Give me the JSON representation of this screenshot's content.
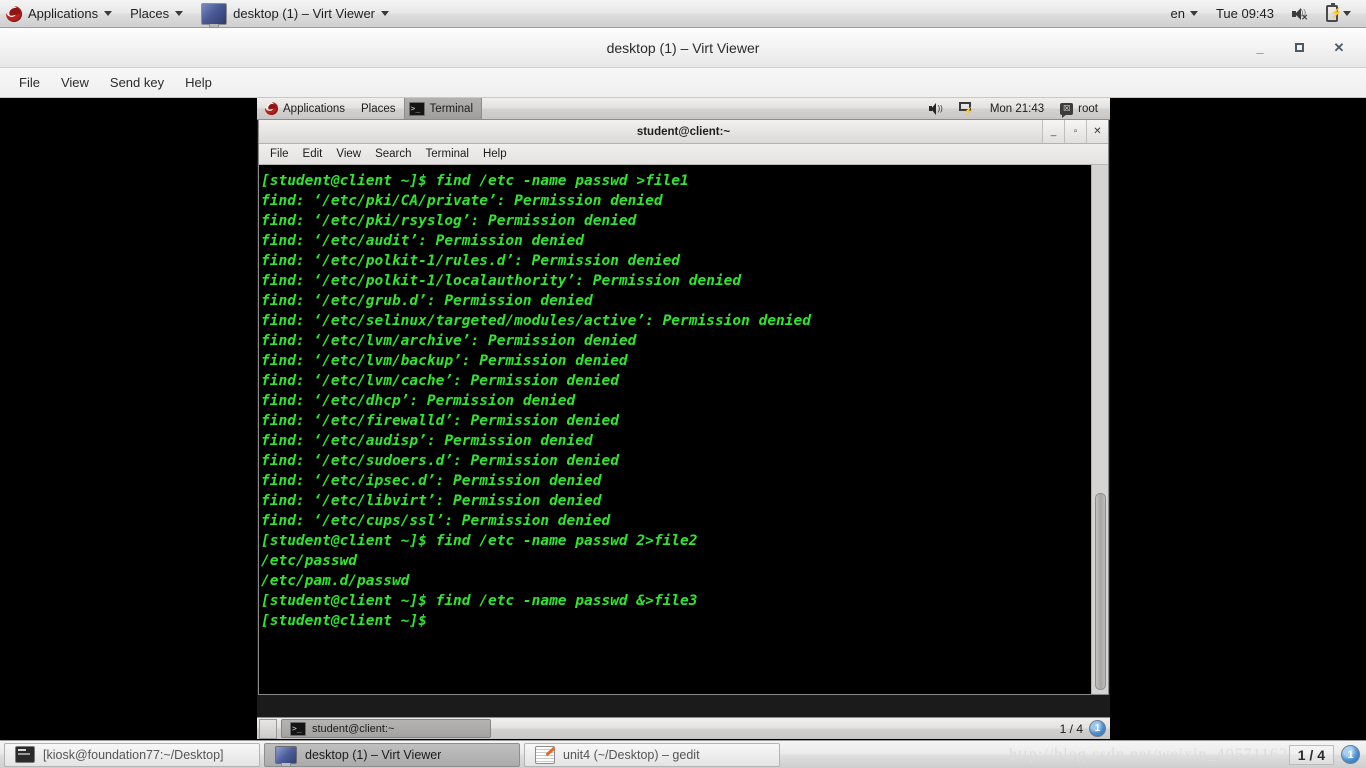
{
  "host_top_panel": {
    "applications_label": "Applications",
    "places_label": "Places",
    "window_task_label": "desktop (1) – Virt Viewer",
    "keyboard_layout": "en",
    "clock": "Tue 09:43"
  },
  "virt_viewer": {
    "title": "desktop (1) – Virt Viewer",
    "menu": [
      "File",
      "View",
      "Send key",
      "Help"
    ],
    "window_buttons": {
      "minimize": "_",
      "maximize": "□",
      "close": "✕"
    }
  },
  "guest": {
    "top_panel": {
      "applications_label": "Applications",
      "places_label": "Places",
      "task_label": "Terminal",
      "clock": "Mon 21:43",
      "user": "root"
    },
    "terminal": {
      "title": "student@client:~",
      "menu": [
        "File",
        "Edit",
        "View",
        "Search",
        "Terminal",
        "Help"
      ],
      "window_buttons": {
        "minimize": "_",
        "maximize": "▫",
        "close": "✕"
      },
      "lines": [
        "[student@client ~]$ find /etc -name passwd >file1",
        "find: ‘/etc/pki/CA/private’: Permission denied",
        "find: ‘/etc/pki/rsyslog’: Permission denied",
        "find: ‘/etc/audit’: Permission denied",
        "find: ‘/etc/polkit-1/rules.d’: Permission denied",
        "find: ‘/etc/polkit-1/localauthority’: Permission denied",
        "find: ‘/etc/grub.d’: Permission denied",
        "find: ‘/etc/selinux/targeted/modules/active’: Permission denied",
        "find: ‘/etc/lvm/archive’: Permission denied",
        "find: ‘/etc/lvm/backup’: Permission denied",
        "find: ‘/etc/lvm/cache’: Permission denied",
        "find: ‘/etc/dhcp’: Permission denied",
        "find: ‘/etc/firewalld’: Permission denied",
        "find: ‘/etc/audisp’: Permission denied",
        "find: ‘/etc/sudoers.d’: Permission denied",
        "find: ‘/etc/ipsec.d’: Permission denied",
        "find: ‘/etc/libvirt’: Permission denied",
        "find: ‘/etc/cups/ssl’: Permission denied",
        "[student@client ~]$ find /etc -name passwd 2>file2",
        "/etc/passwd",
        "/etc/pam.d/passwd",
        "[student@client ~]$ find /etc -name passwd &>file3",
        "[student@client ~]$"
      ],
      "foreground_color": "#2ee62e",
      "background_color": "#000000"
    },
    "bottom_panel": {
      "task_label": "student@client:~",
      "pager": "1 / 4",
      "workspace_badge": "1"
    }
  },
  "host_bottom_panel": {
    "tasks": [
      {
        "label": "[kiosk@foundation77:~/Desktop]",
        "icon": "terminal-icon",
        "active": false
      },
      {
        "label": "desktop (1) – Virt Viewer",
        "icon": "virt-viewer-icon",
        "active": true
      },
      {
        "label": "unit4 (~/Desktop) – gedit",
        "icon": "gedit-icon",
        "active": false
      }
    ],
    "pager": "1 / 4",
    "workspace_badge": "1",
    "watermark": "http://blog.csdn.net/weixin_40571162"
  }
}
